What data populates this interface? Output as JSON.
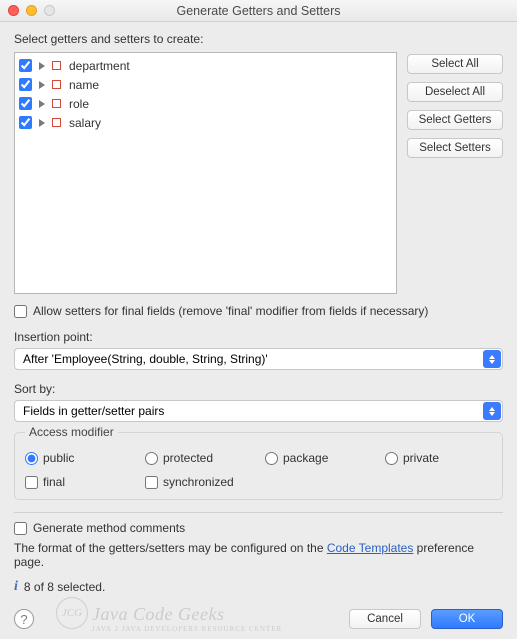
{
  "window": {
    "title": "Generate Getters and Setters"
  },
  "prompt": "Select getters and setters to create:",
  "fields": [
    {
      "label": "department",
      "checked": true
    },
    {
      "label": "name",
      "checked": true
    },
    {
      "label": "role",
      "checked": true
    },
    {
      "label": "salary",
      "checked": true
    }
  ],
  "side_buttons": {
    "select_all": "Select All",
    "deselect_all": "Deselect All",
    "select_getters": "Select Getters",
    "select_setters": "Select Setters"
  },
  "allow_final": {
    "label": "Allow setters for final fields (remove 'final' modifier from fields if necessary)",
    "checked": false
  },
  "insertion_point": {
    "label": "Insertion point:",
    "value": "After 'Employee(String, double, String, String)'"
  },
  "sort_by": {
    "label": "Sort by:",
    "value": "Fields in getter/setter pairs"
  },
  "access": {
    "title": "Access modifier",
    "radios": {
      "public": "public",
      "protected": "protected",
      "package": "package",
      "private": "private"
    },
    "selected": "public",
    "checks": {
      "final": {
        "label": "final",
        "checked": false
      },
      "synchronized": {
        "label": "synchronized",
        "checked": false
      }
    }
  },
  "generate_comments": {
    "label": "Generate method comments",
    "checked": false
  },
  "format_note": {
    "prefix": "The format of the getters/setters may be configured on the ",
    "link": "Code Templates",
    "suffix": " preference page."
  },
  "status": "8 of 8 selected.",
  "footer": {
    "cancel": "Cancel",
    "ok": "OK"
  },
  "watermark": {
    "brand": "Java Code Geeks",
    "tag": "JAVA 2 JAVA DEVELOPERS RESOURCE CENTER",
    "logo": "JCG"
  }
}
